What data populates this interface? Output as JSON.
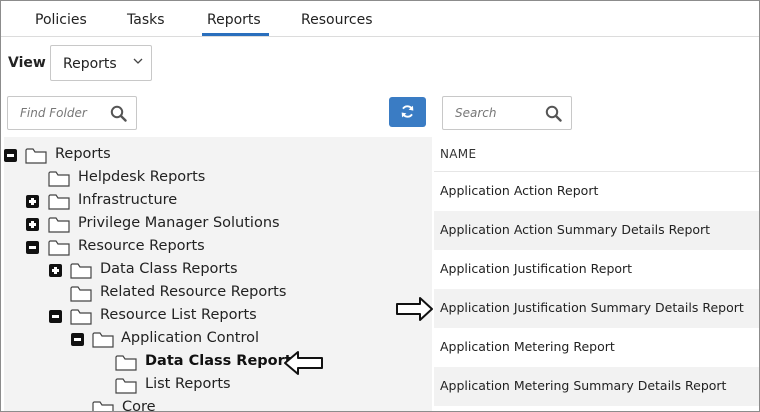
{
  "tabs": [
    {
      "label": "Policies",
      "active": false
    },
    {
      "label": "Tasks",
      "active": false
    },
    {
      "label": "Reports",
      "active": true
    },
    {
      "label": "Resources",
      "active": false
    }
  ],
  "view": {
    "label": "View",
    "selected": "Reports"
  },
  "find_folder": {
    "placeholder": "Find Folder"
  },
  "search": {
    "placeholder": "Search"
  },
  "tree": [
    {
      "label": "Reports",
      "toggle": "minus",
      "bold": false
    },
    {
      "label": "Helpdesk Reports",
      "toggle": "none",
      "bold": false
    },
    {
      "label": "Infrastructure",
      "toggle": "plus",
      "bold": false
    },
    {
      "label": "Privilege Manager Solutions",
      "toggle": "plus",
      "bold": false
    },
    {
      "label": "Resource Reports",
      "toggle": "minus",
      "bold": false
    },
    {
      "label": "Data Class Reports",
      "toggle": "plus",
      "bold": false
    },
    {
      "label": "Related Resource Reports",
      "toggle": "none",
      "bold": false
    },
    {
      "label": "Resource List Reports",
      "toggle": "minus",
      "bold": false
    },
    {
      "label": "Application Control",
      "toggle": "minus",
      "bold": false
    },
    {
      "label": "Data Class Reports",
      "toggle": "none",
      "bold": true
    },
    {
      "label": "List Reports",
      "toggle": "none",
      "bold": false
    },
    {
      "label": "Core",
      "toggle": "none",
      "bold": false
    }
  ],
  "list": {
    "column_header": "NAME",
    "rows": [
      "Application Action Report",
      "Application Action Summary Details Report",
      "Application Justification Report",
      "Application Justification Summary Details Report",
      "Application Metering Report",
      "Application Metering Summary Details Report"
    ]
  },
  "colors": {
    "accent": "#2a6fbd",
    "refresh_button": "#3a7cc4"
  },
  "icons": {
    "refresh": "refresh-icon",
    "search": "magnifier-icon",
    "folder": "folder-icon",
    "callout": "outline-arrow-icon"
  }
}
